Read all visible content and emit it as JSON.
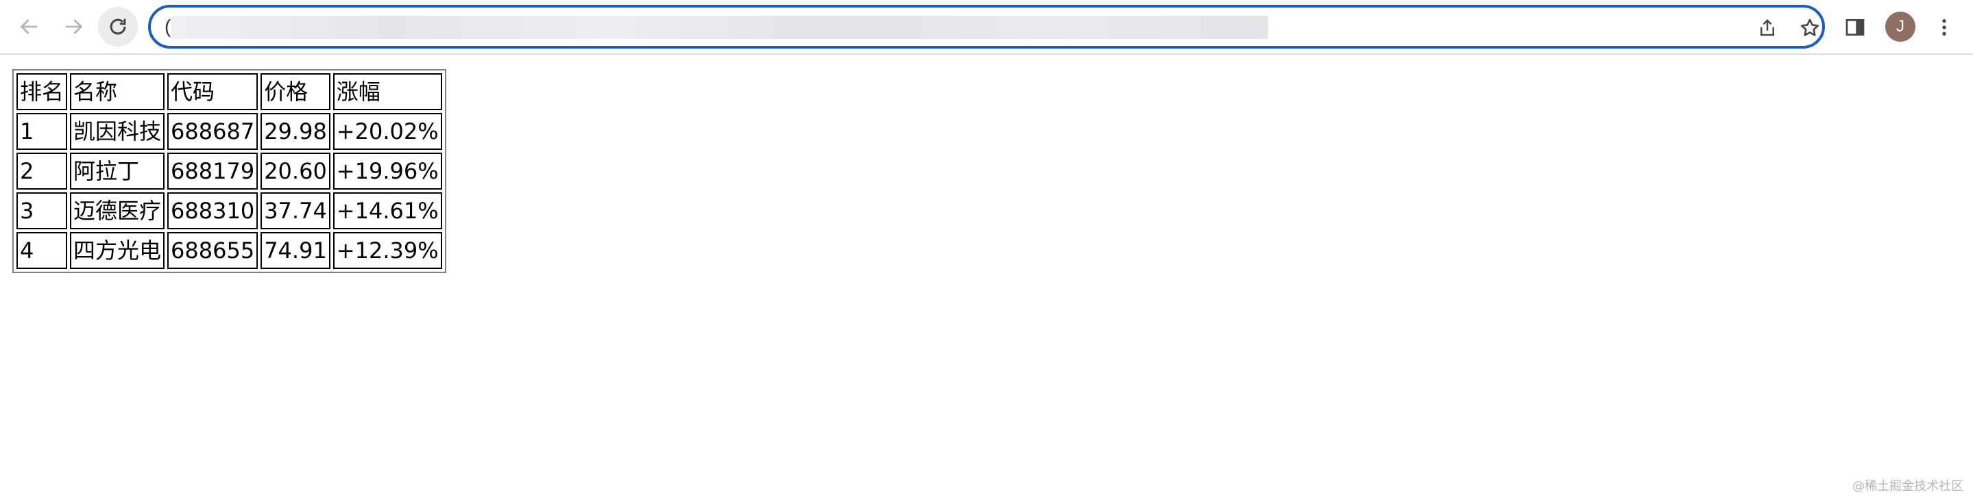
{
  "browser": {
    "address_bar": {
      "text": "(",
      "url_blurred": true
    },
    "profile_initial": "J",
    "accent_color": "#1f5cc1",
    "avatar_color": "#8f6f63"
  },
  "table": {
    "headers": [
      "排名",
      "名称",
      "代码",
      "价格",
      "涨幅"
    ],
    "rows": [
      [
        "1",
        "凯因科技",
        "688687",
        "29.98",
        "+20.02%"
      ],
      [
        "2",
        "阿拉丁",
        "688179",
        "20.60",
        "+19.96%"
      ],
      [
        "3",
        "迈德医疗",
        "688310",
        "37.74",
        "+14.61%"
      ],
      [
        "4",
        "四方光电",
        "688655",
        "74.91",
        "+12.39%"
      ]
    ]
  },
  "watermark": "@稀土掘金技术社区",
  "icons": {
    "back": "arrow-left-icon",
    "forward": "arrow-right-icon",
    "reload": "reload-icon",
    "share": "share-icon",
    "bookmark": "star-icon",
    "side_panel": "side-panel-icon",
    "menu": "kebab-menu-icon"
  }
}
